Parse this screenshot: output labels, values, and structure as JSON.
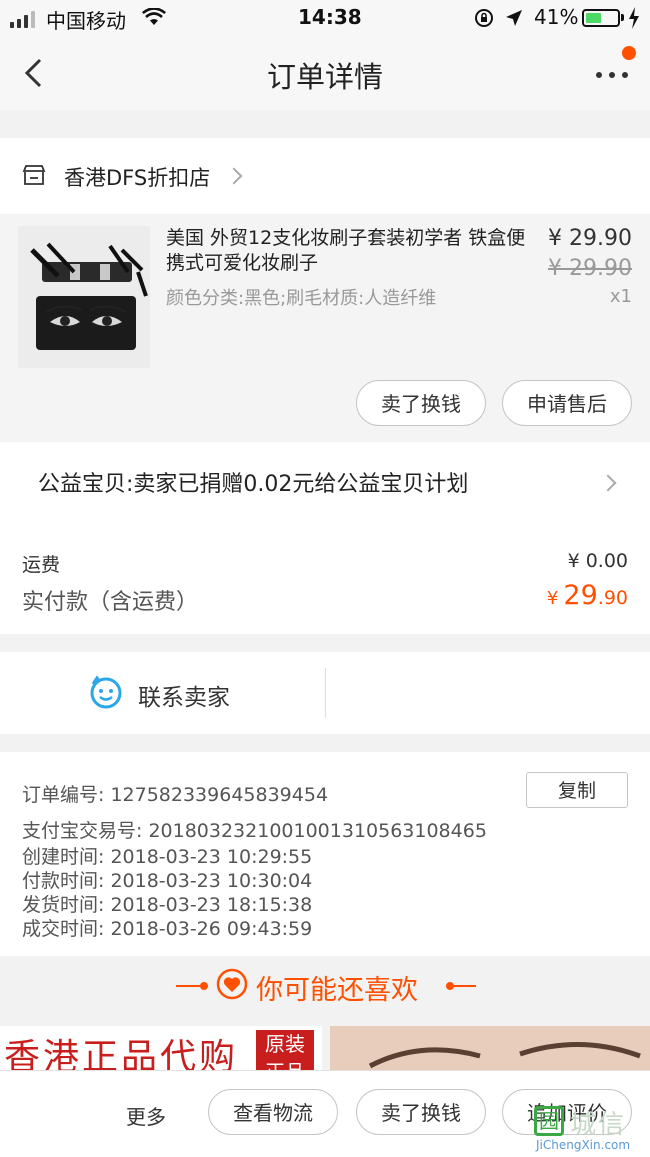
{
  "status_bar": {
    "carrier": "中国移动",
    "time": "14:38",
    "battery": "41%"
  },
  "header": {
    "title": "订单详情"
  },
  "store": {
    "name": "香港DFS折扣店"
  },
  "item": {
    "title": "美国 外贸12支化妆刷子套装初学者 铁盒便携式可爱化妆刷子",
    "spec": "颜色分类:黑色;刷毛材质:人造纤维",
    "price": "¥ 29.90",
    "original_price": "¥ 29.90",
    "quantity": "x1",
    "actions": [
      "卖了换钱",
      "申请售后"
    ]
  },
  "charity": {
    "text": "公益宝贝:卖家已捐赠0.02元给公益宝贝计划"
  },
  "fees": {
    "shipping_label": "运费",
    "shipping_value": "¥ 0.00",
    "paid_label": "实付款（含运费）",
    "paid_currency": "¥",
    "paid_big": "29",
    "paid_small": ".90"
  },
  "contact": {
    "label": "联系卖家"
  },
  "order_info": {
    "copy_label": "复制",
    "rows": [
      "订单编号:   127582339645839454",
      "支付宝交易号:   2018032321001001310563108465",
      "创建时间:   2018-03-23 10:29:55",
      "付款时间:   2018-03-23 10:30:04",
      "发货时间:   2018-03-23 18:15:38",
      "成交时间:   2018-03-26 09:43:59"
    ]
  },
  "recommend": {
    "title": "你可能还喜欢"
  },
  "banner": {
    "left_text": "香港正品代购",
    "badge_text": "原装正品"
  },
  "bottom_bar": {
    "more_label": "更多",
    "actions": [
      "查看物流",
      "卖了换钱",
      "追加评价"
    ]
  },
  "watermark": {
    "text": "城信",
    "sub": "JiChengXin.com"
  },
  "colors": {
    "accent": "#ff5000",
    "contact_icon": "#2aa7e8"
  }
}
